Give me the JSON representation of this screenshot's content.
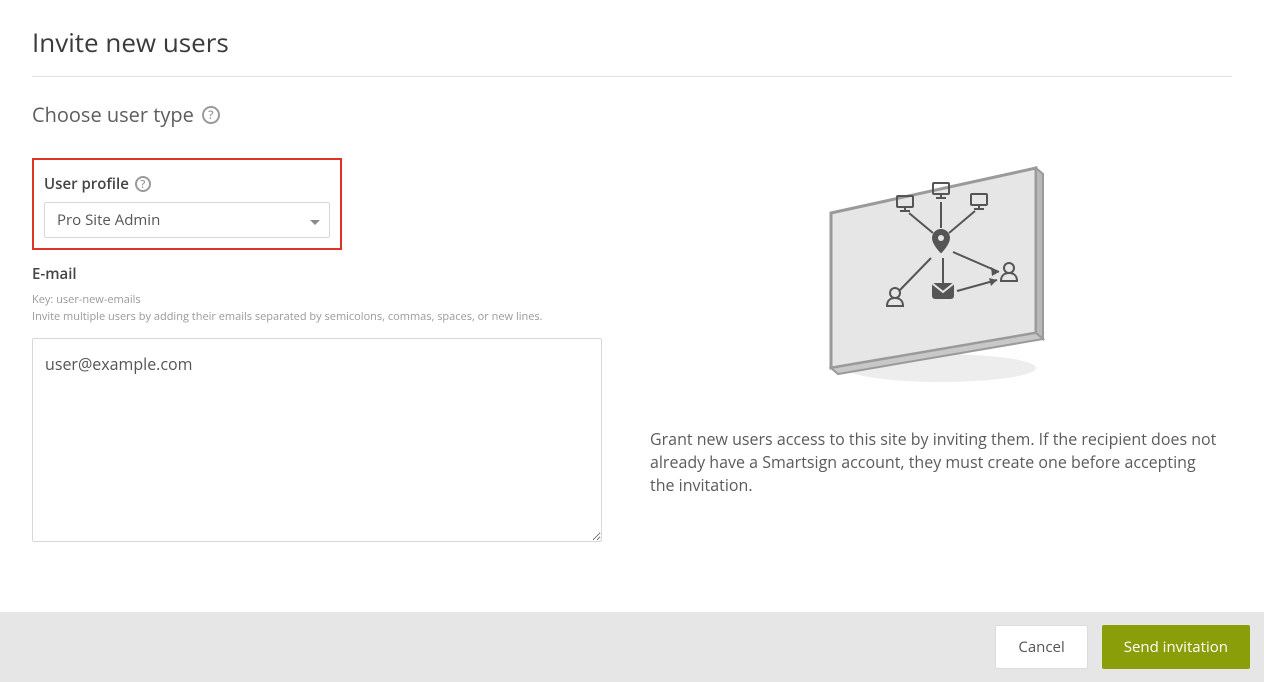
{
  "title": "Invite new users",
  "section_title": "Choose user type",
  "user_profile": {
    "label": "User profile",
    "selected": "Pro Site Admin"
  },
  "email": {
    "label": "E-mail",
    "key_hint": "Key: user-new-emails",
    "multi_hint": "Invite multiple users by adding their emails separated by semicolons, commas, spaces, or new lines.",
    "value": "user@example.com"
  },
  "info_text": "Grant new users access to this site by inviting them. If the recipient does not already have a Smartsign account, they must create one before accepting the invitation.",
  "footer": {
    "cancel": "Cancel",
    "send": "Send invitation"
  },
  "colors": {
    "primary_button": "#8a9e0a",
    "highlight_border": "#e03324"
  }
}
